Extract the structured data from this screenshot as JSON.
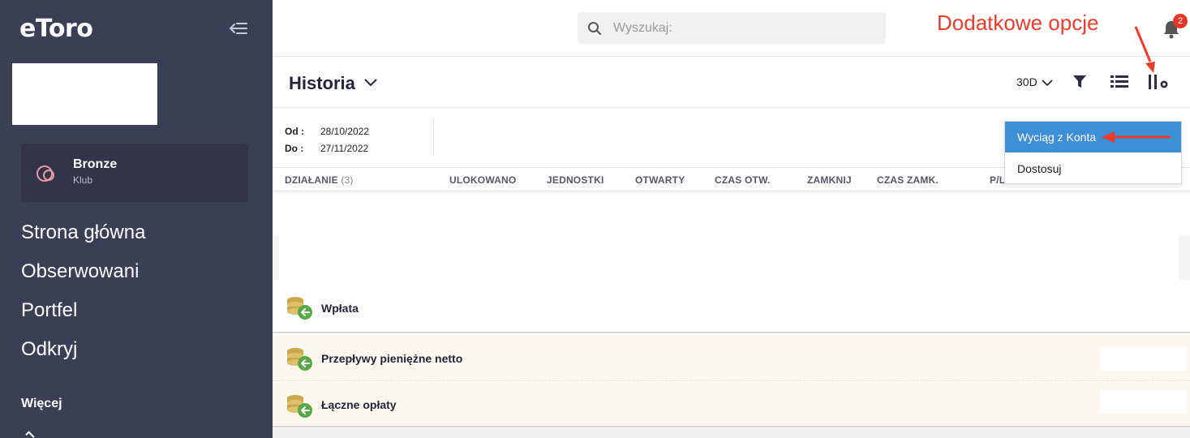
{
  "app": {
    "logo": "eToro"
  },
  "sidebar": {
    "club": {
      "name": "Bronze",
      "sub": "Klub"
    },
    "items": [
      {
        "label": "Strona główna"
      },
      {
        "label": "Obserwowani"
      },
      {
        "label": "Portfel"
      },
      {
        "label": "Odkryj"
      }
    ],
    "more_label": "Więcej"
  },
  "topbar": {
    "search_placeholder": "Wyszukaj:",
    "notifications_count": "2"
  },
  "annotation": {
    "text": "Dodatkowe opcje",
    "color": "#f03a2a"
  },
  "page": {
    "title": "Historia",
    "period": "30D",
    "from_label": "Od :",
    "from_date": "28/10/2022",
    "to_label": "Do :",
    "to_date": "27/11/2022"
  },
  "table": {
    "columns": [
      {
        "label": "DZIAŁANIE",
        "count": "(3)"
      },
      {
        "label": "ULOKOWANO"
      },
      {
        "label": "JEDNOSTKI"
      },
      {
        "label": "OTWARTY"
      },
      {
        "label": "CZAS OTW."
      },
      {
        "label": "ZAMKNIJ"
      },
      {
        "label": "CZAS ZAMK."
      },
      {
        "label": "P/L"
      }
    ],
    "rows": [
      {
        "label": "Wpłata"
      },
      {
        "label": "Przepływy pieniężne netto"
      },
      {
        "label": "Łączne opłaty"
      }
    ]
  },
  "dropdown": {
    "items": [
      {
        "label": "Wyciąg z Konta",
        "active": true
      },
      {
        "label": "Dostosuj",
        "active": false
      }
    ]
  },
  "colors": {
    "sidebar_bg": "#3b3f55",
    "accent_blue": "#3d8fd6",
    "badge_red": "#e5382b",
    "summary_row_bg": "#fdf8ef",
    "coin_gold": "#c9a94c",
    "coin_green": "#5aa84a"
  },
  "icons": [
    "collapse-menu-icon",
    "club-icon",
    "search-icon",
    "bell-icon",
    "chevron-down-icon",
    "filter-icon",
    "list-view-icon",
    "column-settings-icon",
    "coin-stack-icon"
  ]
}
